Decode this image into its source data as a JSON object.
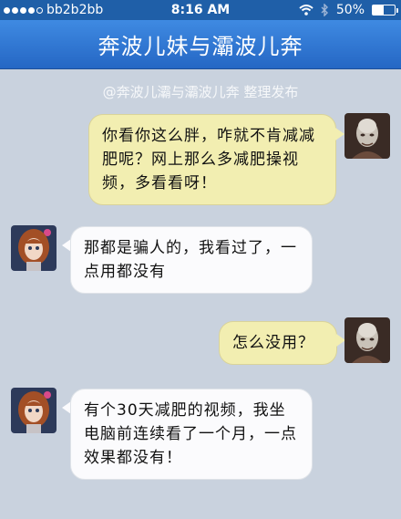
{
  "status_bar": {
    "carrier": "bb2b2bb",
    "time": "8:16 AM",
    "battery": "50%",
    "battery_level": 0.5,
    "signal_icons": [
      "signal-dots-icon",
      "wifi-icon",
      "bluetooth-icon",
      "battery-icon"
    ]
  },
  "nav": {
    "title": "奔波儿妹与灞波儿奔"
  },
  "watermark": "@奔波儿灞与灞波儿奔 整理发布",
  "messages": [
    {
      "side": "out",
      "text": "你看你这么胖，咋就不肯减减肥呢？网上那么多减肥操视频，多看看呀！"
    },
    {
      "side": "in",
      "text": "那都是骗人的，我看过了，一点用都没有"
    },
    {
      "side": "out",
      "text": "怎么没用？"
    },
    {
      "side": "in",
      "text": "有个30天减肥的视频，我坐电脑前连续看了一个月，一点效果都没有！"
    }
  ],
  "colors": {
    "nav_bg": "#2f75d6",
    "chat_bg": "#c9d2de",
    "bubble_out": "#f2eeb1",
    "bubble_in": "#fbfbfd"
  }
}
